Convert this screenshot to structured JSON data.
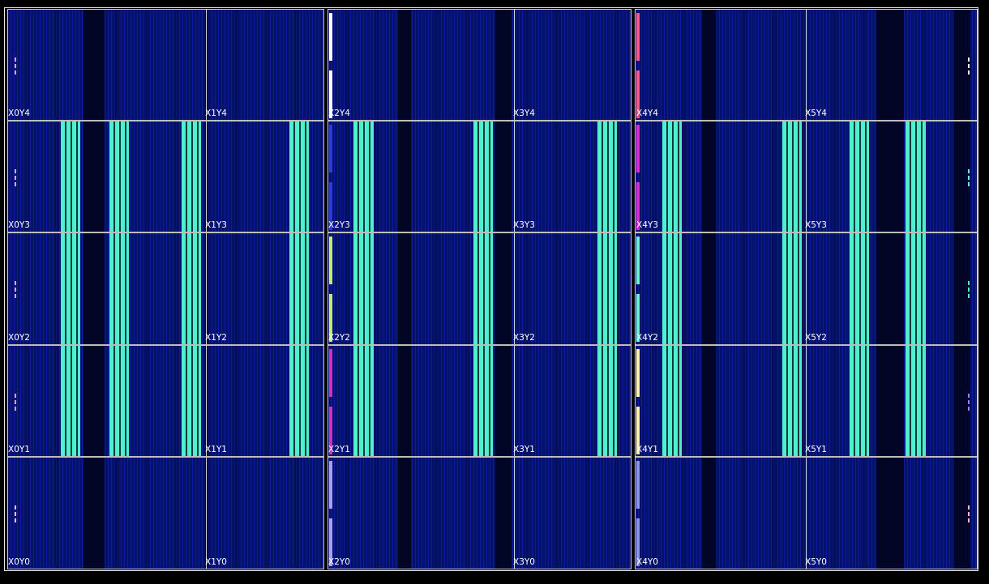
{
  "device_view": {
    "colors": {
      "background": "#000000",
      "fabric": "#06116b",
      "fabric_grid": "#0c1c9a",
      "fabric_dark": "#020626",
      "fabric_mid": "#041052",
      "placed_logic": "#4ef0cf",
      "frame": "#e6e6e6",
      "separator": "#bdbdbd"
    },
    "clock_region_labels": [
      [
        "X0Y4",
        "X1Y4",
        "X2Y4",
        "X3Y4",
        "X4Y4",
        "X5Y4"
      ],
      [
        "X0Y3",
        "X1Y3",
        "X2Y3",
        "X3Y3",
        "X4Y3",
        "X5Y3"
      ],
      [
        "X0Y2",
        "X1Y2",
        "X2Y2",
        "X3Y2",
        "X4Y2",
        "X5Y2"
      ],
      [
        "X0Y1",
        "X1Y1",
        "X2Y1",
        "X3Y1",
        "X4Y1",
        "X5Y1"
      ],
      [
        "X0Y0",
        "X1Y0",
        "X2Y0",
        "X3Y0",
        "X4Y0",
        "X5Y0"
      ]
    ],
    "io_bank_colors": {
      "slr2": [
        "#ffffff",
        "#2c39e6",
        "#c2f069",
        "#e02ab8",
        "#a6a3e6"
      ],
      "slr3": [
        "#ff5a7d",
        "#e02ad9",
        "#6ff0dd",
        "#fff5a3",
        "#8f96e6"
      ]
    },
    "edge_marker_colors": {
      "left": [
        "#ff9be0",
        "#ff9be0",
        "#ff9be0",
        "#ffb347",
        "#ffd27f"
      ],
      "right": [
        "#ffffff",
        "#6ff0e4",
        "#4ef0cf",
        "#9c7cff",
        "#ffb3d9"
      ]
    }
  }
}
